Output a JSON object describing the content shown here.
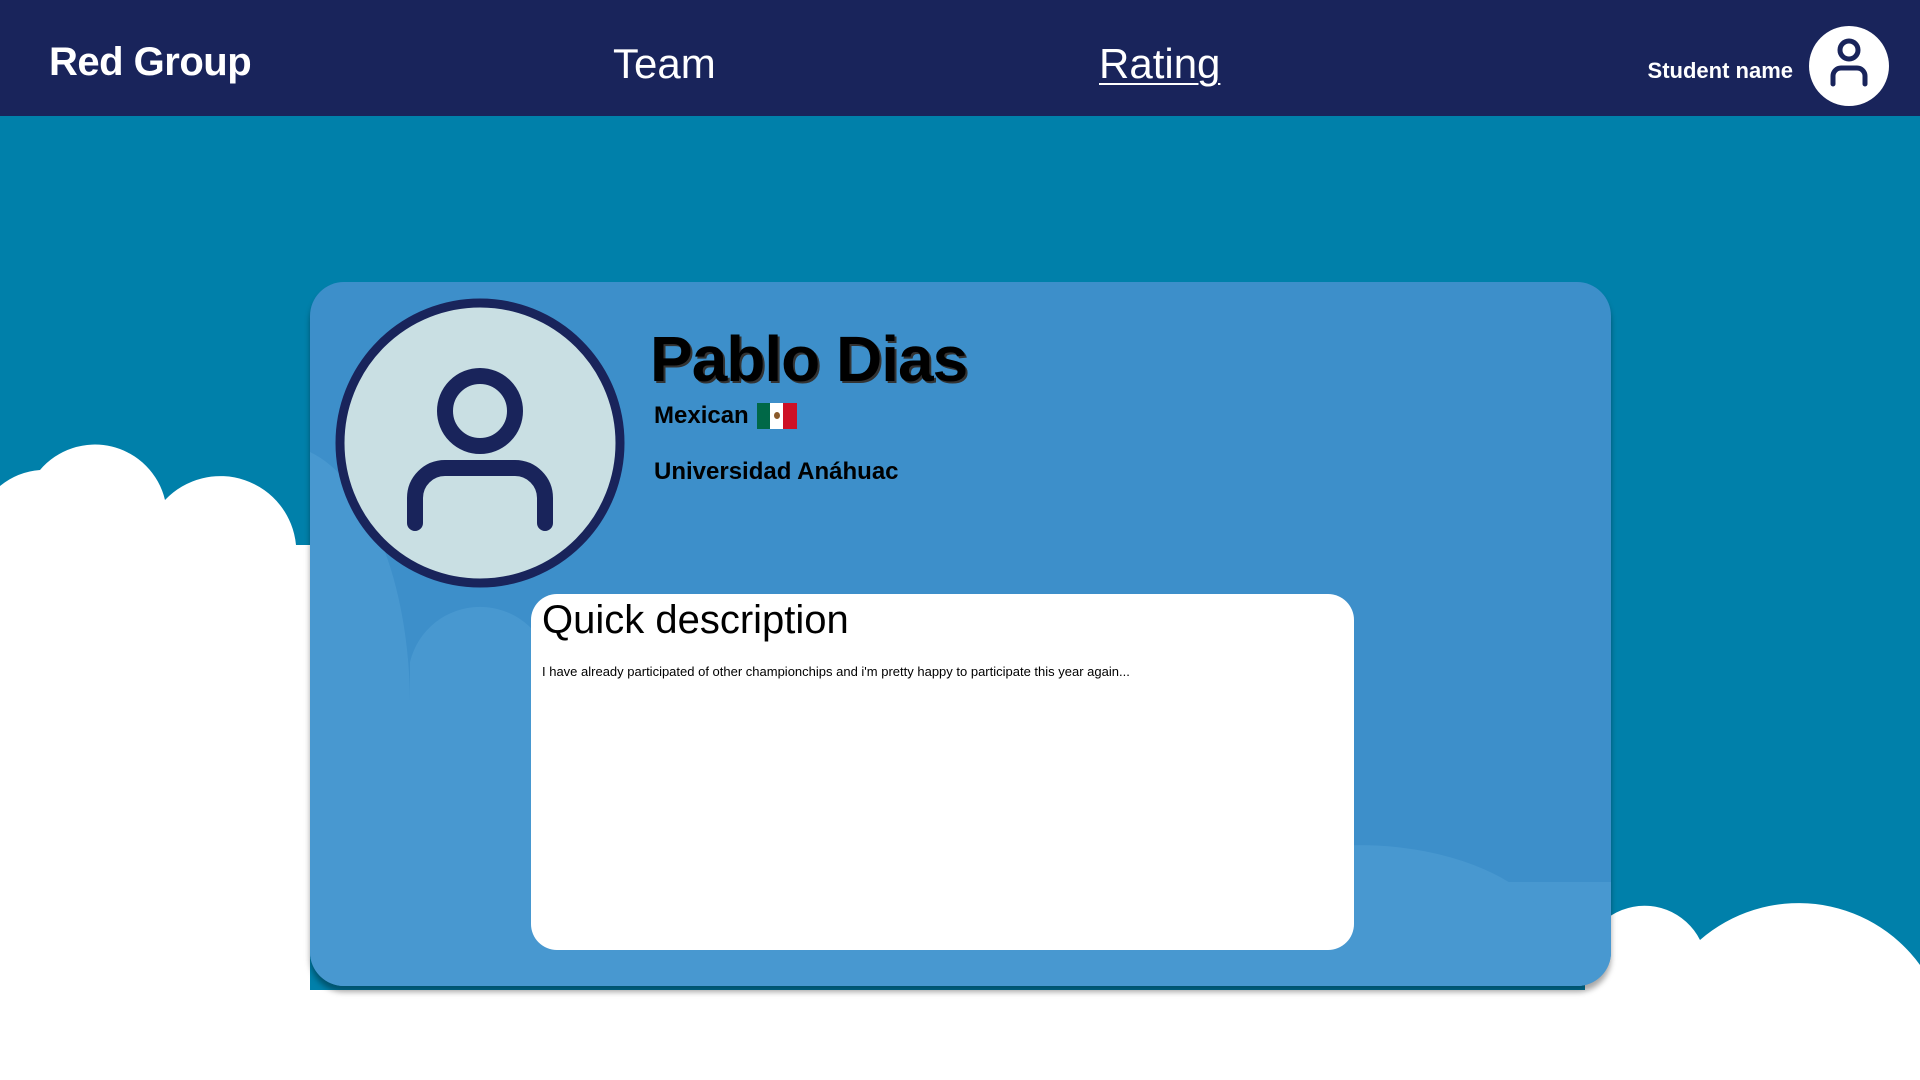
{
  "header": {
    "brand": "Red Group",
    "nav": [
      {
        "label": "Team",
        "active": false
      },
      {
        "label": "Rating",
        "active": true
      }
    ],
    "student_name": "Student name"
  },
  "profile": {
    "name": "Pablo Dias",
    "nationality": "Mexican",
    "flag": "mexico-flag-icon",
    "university": "Universidad Anáhuac",
    "description_title": "Quick description",
    "description": "I have already participated of other championchips and i'm pretty happy to participate this year again..."
  },
  "colors": {
    "header": "#19245b",
    "background": "#0080aa",
    "card": "#3d8fca",
    "avatar_fill": "#c9dfe3"
  }
}
